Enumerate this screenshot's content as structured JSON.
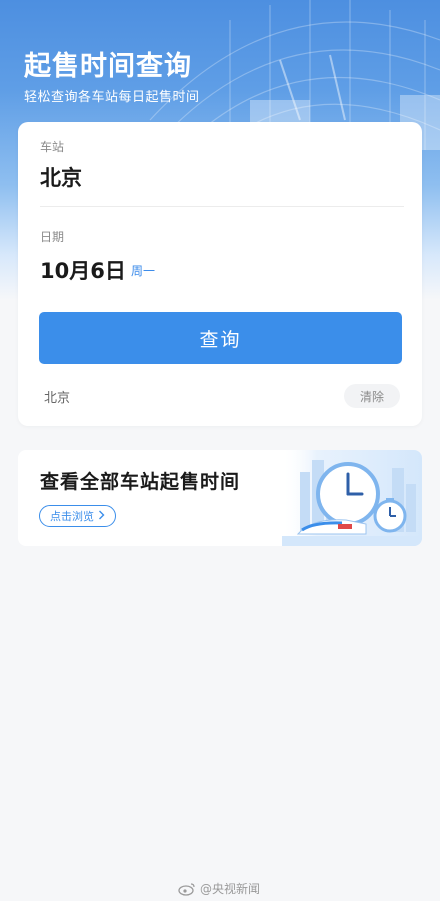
{
  "header": {
    "title": "起售时间查询",
    "subtitle": "轻松查询各车站每日起售时间"
  },
  "form": {
    "station_label": "车站",
    "station_value": "北京",
    "date_label": "日期",
    "date_value": "10月6日",
    "weekday": "周一",
    "query_button": "查询"
  },
  "history": {
    "items": [
      "北京"
    ],
    "clear_label": "清除"
  },
  "banner": {
    "title": "查看全部车站起售时间",
    "button_label": "点击浏览",
    "button_icon": "chevron-right-icon"
  },
  "watermark": {
    "text": "@央视新闻"
  },
  "colors": {
    "accent": "#3b8eea",
    "header_top": "#4d8fe0",
    "background": "#f6f7f9"
  }
}
